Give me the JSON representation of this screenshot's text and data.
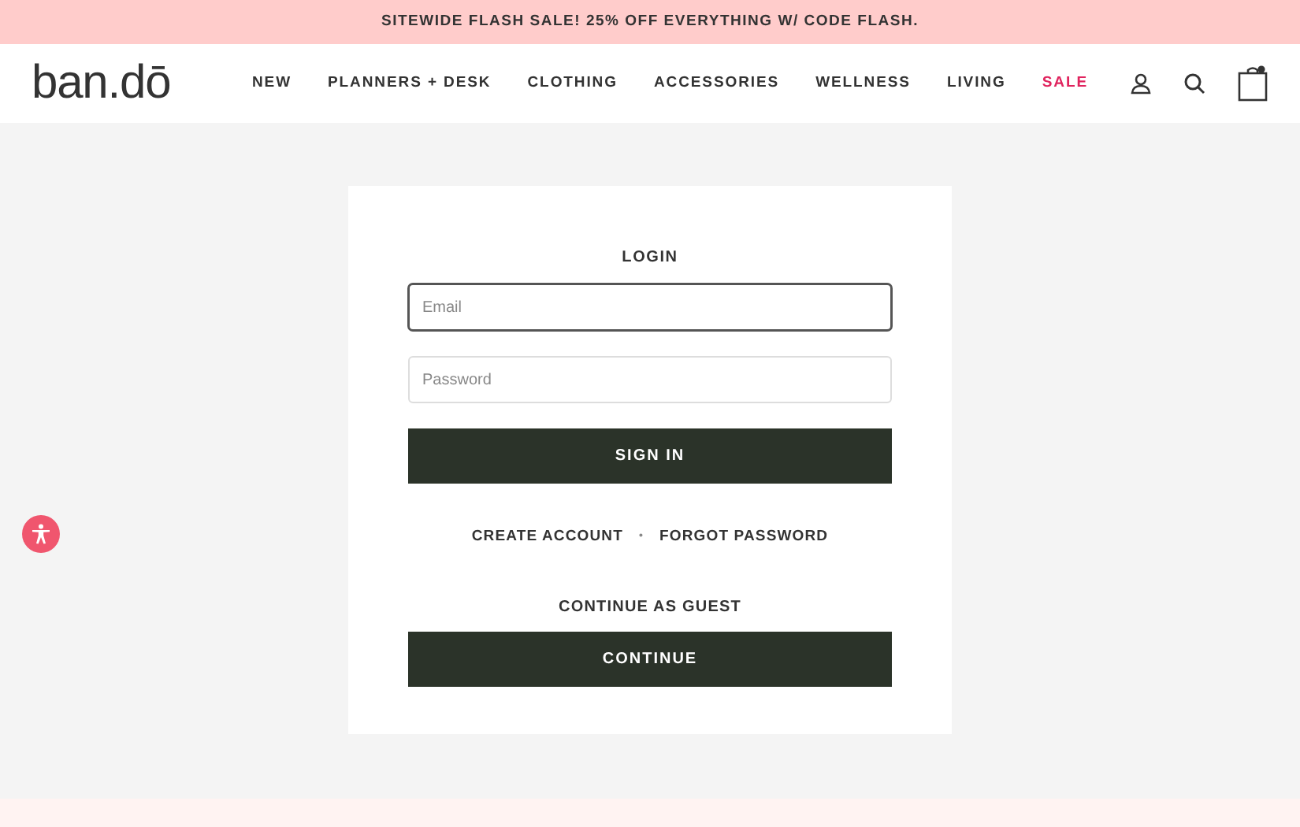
{
  "announcement": "SITEWIDE FLASH SALE! 25% OFF EVERYTHING W/ CODE FLASH.",
  "logo": "ban.dō",
  "nav": [
    {
      "label": "NEW",
      "highlighted": false
    },
    {
      "label": "PLANNERS + DESK",
      "highlighted": false
    },
    {
      "label": "CLOTHING",
      "highlighted": false
    },
    {
      "label": "ACCESSORIES",
      "highlighted": false
    },
    {
      "label": "WELLNESS",
      "highlighted": false
    },
    {
      "label": "LIVING",
      "highlighted": false
    },
    {
      "label": "SALE",
      "highlighted": true
    }
  ],
  "login": {
    "title": "LOGIN",
    "fields": [
      {
        "placeholder": "Email",
        "focused": true
      },
      {
        "placeholder": "Password",
        "focused": false
      }
    ],
    "submit": "SIGN IN",
    "links": [
      "CREATE ACCOUNT",
      "FORGOT PASSWORD"
    ],
    "separator": "•",
    "guest_title": "CONTINUE AS GUEST",
    "guest_button": "CONTINUE"
  }
}
